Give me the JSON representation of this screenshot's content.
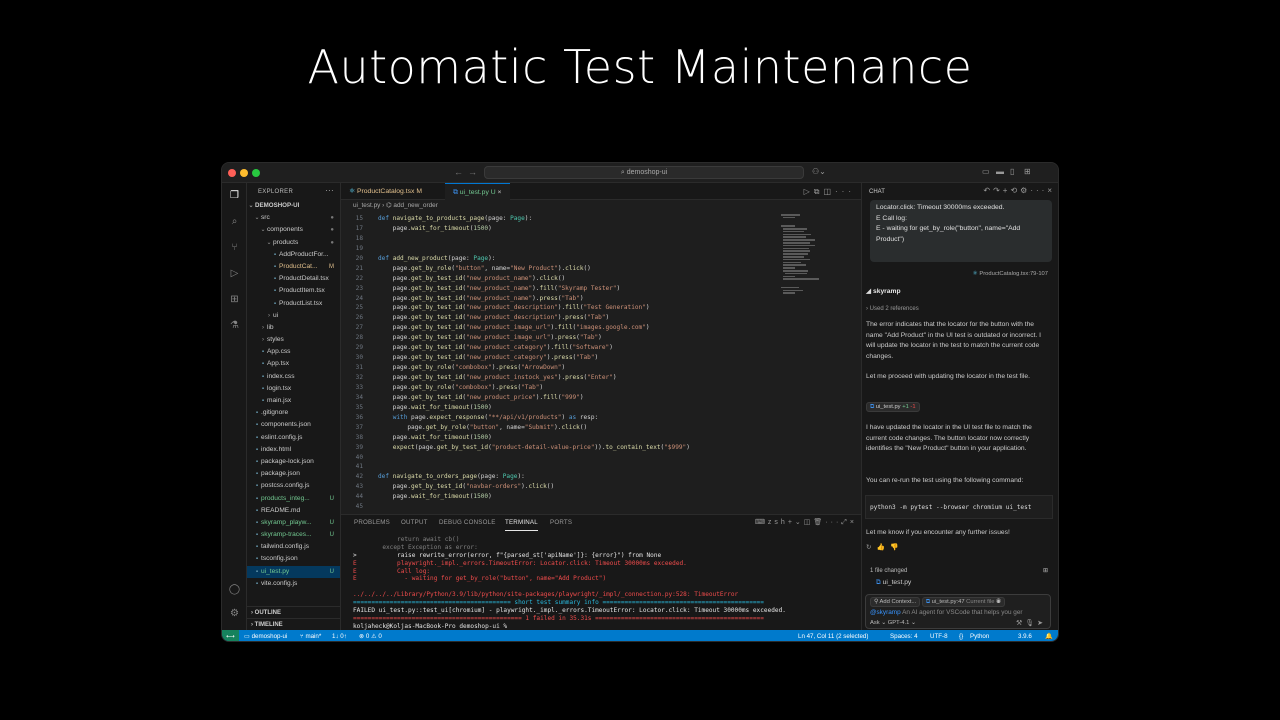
{
  "slide_title": "Automatic Test Maintenance",
  "command_center": {
    "search_label": "demoshop-ui"
  },
  "explorer": {
    "header": "EXPLORER",
    "root": "DEMOSHOP-UI",
    "items": [
      {
        "label": "src",
        "depth": 1,
        "kind": "folder-open",
        "state": "modified-dot"
      },
      {
        "label": "components",
        "depth": 2,
        "kind": "folder-open",
        "state": "modified-dot"
      },
      {
        "label": "products",
        "depth": 3,
        "kind": "folder-open",
        "state": "modified-dot"
      },
      {
        "label": "AddProductFor...",
        "depth": 4,
        "kind": "file",
        "state": ""
      },
      {
        "label": "ProductCat...",
        "depth": 4,
        "kind": "file",
        "state": "M"
      },
      {
        "label": "ProductDetail.tsx",
        "depth": 4,
        "kind": "file",
        "state": ""
      },
      {
        "label": "ProductItem.tsx",
        "depth": 4,
        "kind": "file",
        "state": ""
      },
      {
        "label": "ProductList.tsx",
        "depth": 4,
        "kind": "file",
        "state": ""
      },
      {
        "label": "ui",
        "depth": 3,
        "kind": "folder",
        "state": ""
      },
      {
        "label": "lib",
        "depth": 2,
        "kind": "folder",
        "state": ""
      },
      {
        "label": "styles",
        "depth": 2,
        "kind": "folder",
        "state": ""
      },
      {
        "label": "App.css",
        "depth": 2,
        "kind": "file",
        "state": ""
      },
      {
        "label": "App.tsx",
        "depth": 2,
        "kind": "file",
        "state": ""
      },
      {
        "label": "index.css",
        "depth": 2,
        "kind": "file",
        "state": ""
      },
      {
        "label": "login.tsx",
        "depth": 2,
        "kind": "file",
        "state": ""
      },
      {
        "label": "main.jsx",
        "depth": 2,
        "kind": "file",
        "state": ""
      },
      {
        "label": ".gitignore",
        "depth": 1,
        "kind": "file",
        "state": ""
      },
      {
        "label": "components.json",
        "depth": 1,
        "kind": "file",
        "state": ""
      },
      {
        "label": "eslint.config.js",
        "depth": 1,
        "kind": "file",
        "state": ""
      },
      {
        "label": "index.html",
        "depth": 1,
        "kind": "file",
        "state": ""
      },
      {
        "label": "package-lock.json",
        "depth": 1,
        "kind": "file",
        "state": ""
      },
      {
        "label": "package.json",
        "depth": 1,
        "kind": "file",
        "state": ""
      },
      {
        "label": "postcss.config.js",
        "depth": 1,
        "kind": "file",
        "state": ""
      },
      {
        "label": "products_integ...",
        "depth": 1,
        "kind": "file",
        "state": "U"
      },
      {
        "label": "README.md",
        "depth": 1,
        "kind": "file",
        "state": ""
      },
      {
        "label": "skyramp_playw...",
        "depth": 1,
        "kind": "file",
        "state": "U"
      },
      {
        "label": "skyramp-traces...",
        "depth": 1,
        "kind": "file",
        "state": "U"
      },
      {
        "label": "tailwind.config.js",
        "depth": 1,
        "kind": "file",
        "state": ""
      },
      {
        "label": "tsconfig.json",
        "depth": 1,
        "kind": "file",
        "state": ""
      },
      {
        "label": "ui_test.py",
        "depth": 1,
        "kind": "file",
        "state": "U",
        "selected": true
      },
      {
        "label": "vite.config.js",
        "depth": 1,
        "kind": "file",
        "state": ""
      }
    ],
    "outline_label": "OUTLINE",
    "timeline_label": "TIMELINE"
  },
  "editor": {
    "tabs": [
      {
        "label": "ProductCatalog.tsx",
        "badge": "M"
      },
      {
        "label": "ui_test.py",
        "badge": "U",
        "active": true
      }
    ],
    "breadcrumb": [
      "ui_test.py",
      "add_new_order"
    ],
    "code_lines": [
      {
        "n": "15",
        "text": "def navigate_to_products_page(page: Page):"
      },
      {
        "n": "17",
        "text": "    page.wait_for_timeout(1500)"
      },
      {
        "n": "18",
        "text": ""
      },
      {
        "n": "19",
        "text": ""
      },
      {
        "n": "20",
        "text": "def add_new_product(page: Page):"
      },
      {
        "n": "21",
        "text": "    page.get_by_role(\"button\", name=\"New Product\").click()"
      },
      {
        "n": "22",
        "text": "    page.get_by_test_id(\"new_product_name\").click()"
      },
      {
        "n": "23",
        "text": "    page.get_by_test_id(\"new_product_name\").fill(\"Skyramp Tester\")"
      },
      {
        "n": "24",
        "text": "    page.get_by_test_id(\"new_product_name\").press(\"Tab\")"
      },
      {
        "n": "25",
        "text": "    page.get_by_test_id(\"new_product_description\").fill(\"Test Generation\")"
      },
      {
        "n": "26",
        "text": "    page.get_by_test_id(\"new_product_description\").press(\"Tab\")"
      },
      {
        "n": "27",
        "text": "    page.get_by_test_id(\"new_product_image_url\").fill(\"images.google.com\")"
      },
      {
        "n": "28",
        "text": "    page.get_by_test_id(\"new_product_image_url\").press(\"Tab\")"
      },
      {
        "n": "29",
        "text": "    page.get_by_test_id(\"new_product_category\").fill(\"Software\")"
      },
      {
        "n": "30",
        "text": "    page.get_by_test_id(\"new_product_category\").press(\"Tab\")"
      },
      {
        "n": "31",
        "text": "    page.get_by_role(\"combobox\").press(\"ArrowDown\")"
      },
      {
        "n": "32",
        "text": "    page.get_by_test_id(\"new_product_instock_yes\").press(\"Enter\")"
      },
      {
        "n": "33",
        "text": "    page.get_by_role(\"combobox\").press(\"Tab\")"
      },
      {
        "n": "34",
        "text": "    page.get_by_test_id(\"new_product_price\").fill(\"999\")"
      },
      {
        "n": "35",
        "text": "    page.wait_for_timeout(1500)"
      },
      {
        "n": "36",
        "text": "    with page.expect_response(\"**/api/v1/products\") as resp:"
      },
      {
        "n": "37",
        "text": "        page.get_by_role(\"button\", name=\"Submit\").click()"
      },
      {
        "n": "38",
        "text": "    page.wait_for_timeout(1500)"
      },
      {
        "n": "39",
        "text": "    expect(page.get_by_test_id(\"product-detail-value-price\")).to_contain_text(\"$999\")"
      },
      {
        "n": "40",
        "text": ""
      },
      {
        "n": "41",
        "text": ""
      },
      {
        "n": "42",
        "text": "def navigate_to_orders_page(page: Page):"
      },
      {
        "n": "43",
        "text": "    page.get_by_test_id(\"navbar-orders\").click()"
      },
      {
        "n": "44",
        "text": "    page.wait_for_timeout(1500)"
      },
      {
        "n": "45",
        "text": ""
      }
    ]
  },
  "panel": {
    "tabs": [
      "PROBLEMS",
      "OUTPUT",
      "DEBUG CONSOLE",
      "TERMINAL",
      "PORTS"
    ],
    "active_tab": "TERMINAL",
    "shell_label": "zsh",
    "terminal_lines": [
      {
        "cls": "tdim",
        "text": "            return await cb()"
      },
      {
        "cls": "tdim",
        "text": "        except Exception as error:"
      },
      {
        "cls": "twhite",
        "text": ">           raise rewrite_error(error, f\"{parsed_st['apiName']}: {error}\") from None"
      },
      {
        "cls": "tred",
        "text": "E           playwright._impl._errors.TimeoutError: Locator.click: Timeout 30000ms exceeded."
      },
      {
        "cls": "tred",
        "text": "E           Call log:"
      },
      {
        "cls": "tred",
        "text": "E             - waiting for get_by_role(\"button\", name=\"Add Product\")"
      },
      {
        "cls": "twhite",
        "text": ""
      },
      {
        "cls": "tred",
        "text": "../../../../Library/Python/3.9/lib/python/site-packages/playwright/_impl/_connection.py:528: TimeoutError"
      },
      {
        "cls": "tcyan",
        "text": "=========================================== short test summary info ============================================"
      },
      {
        "cls": "twhite",
        "text": "FAILED ui_test.py::test_ui[chromium] - playwright._impl._errors.TimeoutError: Locator.click: Timeout 30000ms exceeded."
      },
      {
        "cls": "tred",
        "text": "============================================== 1 failed in 35.31s =============================================="
      },
      {
        "cls": "twhite",
        "text": "koljaheck@Koljas-MacBook-Pro demoshop-ui % "
      }
    ]
  },
  "chat": {
    "header": "CHAT",
    "user_message_lines": [
      "Locator.click: Timeout 30000ms exceeded.",
      "E Call log:",
      "E - waiting for get_by_role(\"button\", name=\"Add",
      "Product\")"
    ],
    "user_ref": "ProductCatalog.tsx:79-107",
    "agent_name": "skyramp",
    "references": "Used 2 references",
    "paragraphs": [
      "The error indicates that the locator for the button with the name \"Add Product\" in the UI test is outdated or incorrect. I will update the locator in the test to match the current code changes.",
      "Let me proceed with updating the locator in the test file.",
      "I have updated the locator in the UI test file to match the current code changes. The button locator now correctly identifies the \"New Product\" button in your application.",
      "You can re-run the test using the following command:",
      "Let me know if you encounter any further issues!"
    ],
    "edit_chip": {
      "file": "ui_test.py",
      "added": "+1",
      "removed": "-1"
    },
    "command": "python3 -m pytest --browser chromium ui_test",
    "files_changed_label": "1 file changed",
    "changed_file": "ui_test.py",
    "add_context": "Add Context...",
    "current_file_chip": "ui_test.py:47",
    "current_file_suffix": "Current file",
    "mention": "@skyramp",
    "input_hint": "An AI agent for VSCode that helps you ger",
    "mode": "Ask",
    "model": "GPT-4.1"
  },
  "statusbar": {
    "branch": "demoshop-ui",
    "git": "main*",
    "sync": "1↓ 0↑",
    "problems": "⊗ 0 ⚠ 0",
    "cursor": "Ln 47, Col 11 (2 selected)",
    "spaces": "Spaces: 4",
    "encoding": "UTF-8",
    "language": "Python",
    "version": "3.9.6"
  }
}
